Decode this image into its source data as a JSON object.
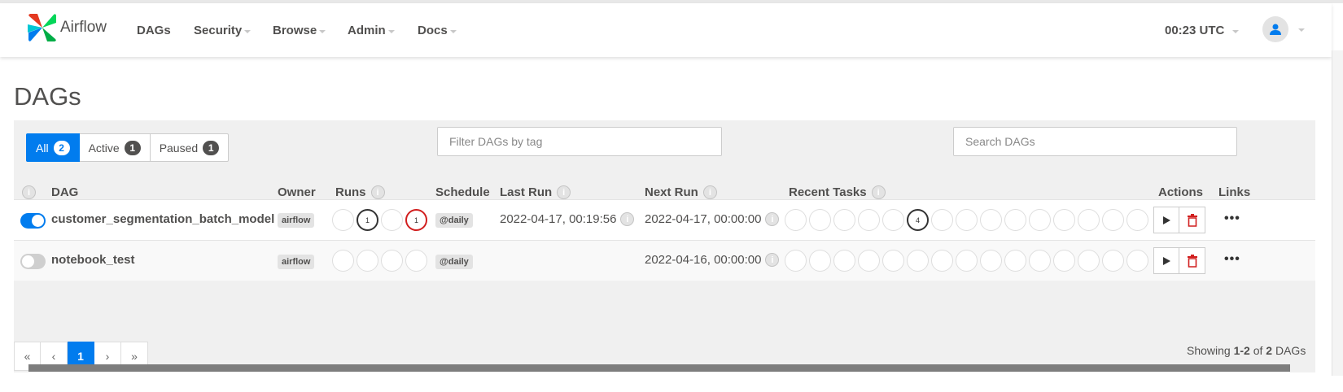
{
  "app": {
    "name": "Airflow",
    "brand_colors": [
      "#017cee",
      "#e43921",
      "#00ad46",
      "#04d659"
    ]
  },
  "nav": {
    "items": [
      "DAGs",
      "Security",
      "Browse",
      "Admin",
      "Docs"
    ],
    "clock": "00:23 UTC"
  },
  "page": {
    "title": "DAGs"
  },
  "filters": {
    "status_buttons": [
      {
        "label": "All",
        "count": "2",
        "active": true
      },
      {
        "label": "Active",
        "count": "1",
        "active": false
      },
      {
        "label": "Paused",
        "count": "1",
        "active": false
      }
    ],
    "tag_placeholder": "Filter DAGs by tag",
    "search_placeholder": "Search DAGs"
  },
  "table": {
    "headers": {
      "dag": "DAG",
      "owner": "Owner",
      "runs": "Runs",
      "schedule": "Schedule",
      "last_run": "Last Run",
      "next_run": "Next Run",
      "recent_tasks": "Recent Tasks",
      "actions": "Actions",
      "links": "Links"
    },
    "rows": [
      {
        "active": true,
        "dag_id": "customer_segmentation_batch_model",
        "owner": "airflow",
        "runs": [
          "",
          "1",
          "",
          "1"
        ],
        "schedule": "@daily",
        "last_run": "2022-04-17, 00:19:56",
        "next_run": "2022-04-17, 00:00:00",
        "recent_tasks_count_label": "4"
      },
      {
        "active": false,
        "dag_id": "notebook_test",
        "owner": "airflow",
        "runs": [
          "",
          "",
          "",
          ""
        ],
        "schedule": "@daily",
        "last_run": "",
        "next_run": "2022-04-16, 00:00:00",
        "recent_tasks_count_label": ""
      }
    ]
  },
  "pagination": {
    "first": "«",
    "prev": "‹",
    "current": "1",
    "next": "›",
    "last": "»"
  },
  "summary": {
    "prefix": "Showing ",
    "range": "1-2",
    "of": " of ",
    "total": "2",
    "suffix": " DAGs"
  },
  "colors": {
    "accent": "#017cee",
    "failed": "#d11e1e",
    "running": "#333333"
  },
  "icons": [
    "airflow-logo-icon",
    "user-icon",
    "info-icon",
    "play-icon",
    "trash-icon",
    "more-dots-icon"
  ]
}
